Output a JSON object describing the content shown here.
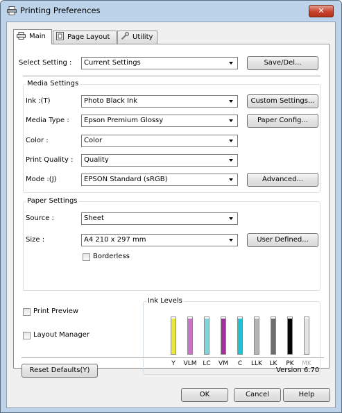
{
  "window": {
    "title": "Printing Preferences",
    "close_glyph": "✕"
  },
  "tabs": [
    {
      "label": "Main",
      "icon": "printer-icon",
      "active": true
    },
    {
      "label": "Page Layout",
      "icon": "page-layout-icon",
      "active": false
    },
    {
      "label": "Utility",
      "icon": "utility-wrench-icon",
      "active": false
    }
  ],
  "select_setting": {
    "label": "Select Setting :",
    "value": "Current Settings",
    "button": "Save/Del..."
  },
  "media_settings": {
    "title": "Media Settings",
    "ink": {
      "label": "Ink :(T)",
      "value": "Photo Black Ink",
      "button": "Custom Settings..."
    },
    "media_type": {
      "label": "Media Type :",
      "value": "Epson Premium Glossy",
      "button": "Paper Config..."
    },
    "color": {
      "label": "Color :",
      "value": "Color"
    },
    "print_quality": {
      "label": "Print Quality :",
      "value": "Quality"
    },
    "mode": {
      "label": "Mode :(J)",
      "value": "EPSON Standard (sRGB)",
      "button": "Advanced..."
    }
  },
  "paper_settings": {
    "title": "Paper Settings",
    "source": {
      "label": "Source :",
      "value": "Sheet"
    },
    "size": {
      "label": "Size :",
      "value": "A4 210 x 297 mm",
      "button": "User Defined..."
    },
    "borderless": {
      "label": "Borderless",
      "checked": false
    }
  },
  "options": {
    "print_preview": {
      "label": "Print Preview",
      "checked": false
    },
    "layout_manager": {
      "label": "Layout Manager",
      "checked": false
    }
  },
  "ink_levels": {
    "title": "Ink Levels",
    "inks": [
      {
        "name": "Y",
        "color": "#e8e83c",
        "level": 0.96,
        "muted": false
      },
      {
        "name": "VLM",
        "color": "#c873c8",
        "level": 0.96,
        "muted": false
      },
      {
        "name": "LC",
        "color": "#7fd4dc",
        "level": 0.96,
        "muted": false
      },
      {
        "name": "VM",
        "color": "#a0309a",
        "level": 0.96,
        "muted": false
      },
      {
        "name": "C",
        "color": "#1ec2d4",
        "level": 0.96,
        "muted": false
      },
      {
        "name": "LLK",
        "color": "#b4b4b4",
        "level": 0.96,
        "muted": false
      },
      {
        "name": "LK",
        "color": "#6e6e6e",
        "level": 0.96,
        "muted": false
      },
      {
        "name": "PK",
        "color": "#050505",
        "level": 0.96,
        "muted": false
      },
      {
        "name": "MK",
        "color": "#e4e4e4",
        "level": 0.96,
        "muted": true
      }
    ]
  },
  "footer_panel": {
    "reset_button": "Reset Defaults(Y)",
    "version": "Version 6.70"
  },
  "dialog_buttons": {
    "ok": "OK",
    "cancel": "Cancel",
    "help": "Help"
  }
}
